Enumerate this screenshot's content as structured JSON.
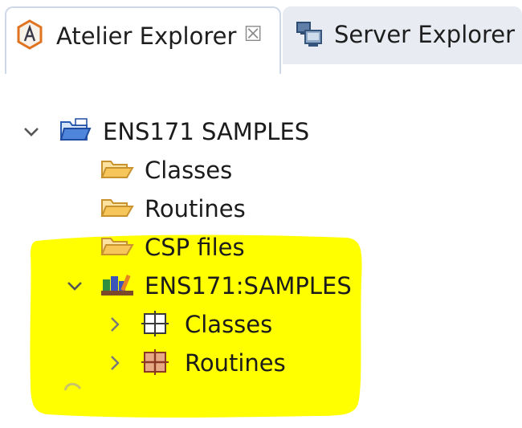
{
  "tabs": [
    {
      "label": "Atelier Explorer",
      "icon": "atelier-icon",
      "active": true,
      "close_glyph": "☒"
    },
    {
      "label": "Server Explorer",
      "icon": "server-icon",
      "active": false
    }
  ],
  "tree": {
    "project": {
      "label": "ENS171 SAMPLES",
      "expanded": true,
      "icon": "project-folder-icon"
    },
    "project_children": [
      {
        "label": "Classes",
        "icon": "folder-open-icon"
      },
      {
        "label": "Routines",
        "icon": "folder-open-icon"
      },
      {
        "label": "CSP files",
        "icon": "folder-open-icon"
      }
    ],
    "namespace": {
      "label": "ENS171:SAMPLES",
      "expanded": true,
      "icon": "namespace-books-icon"
    },
    "namespace_children": [
      {
        "label": "Classes",
        "icon": "class-grid-icon",
        "expanded": false
      },
      {
        "label": "Routines",
        "icon": "routine-grid-icon",
        "expanded": false
      }
    ]
  },
  "colors": {
    "highlight": "#ffff00",
    "folder": "#f1c86a",
    "project_folder": "#3b6fc9",
    "routine_grid": "#b5553a"
  }
}
